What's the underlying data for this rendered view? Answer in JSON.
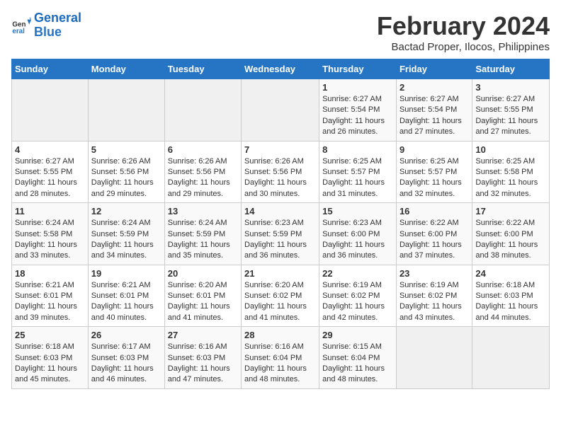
{
  "logo": {
    "line1": "General",
    "line2": "Blue"
  },
  "title": "February 2024",
  "location": "Bactad Proper, Ilocos, Philippines",
  "headers": [
    "Sunday",
    "Monday",
    "Tuesday",
    "Wednesday",
    "Thursday",
    "Friday",
    "Saturday"
  ],
  "weeks": [
    [
      {
        "day": "",
        "info": ""
      },
      {
        "day": "",
        "info": ""
      },
      {
        "day": "",
        "info": ""
      },
      {
        "day": "",
        "info": ""
      },
      {
        "day": "1",
        "info": "Sunrise: 6:27 AM\nSunset: 5:54 PM\nDaylight: 11 hours and 26 minutes."
      },
      {
        "day": "2",
        "info": "Sunrise: 6:27 AM\nSunset: 5:54 PM\nDaylight: 11 hours and 27 minutes."
      },
      {
        "day": "3",
        "info": "Sunrise: 6:27 AM\nSunset: 5:55 PM\nDaylight: 11 hours and 27 minutes."
      }
    ],
    [
      {
        "day": "4",
        "info": "Sunrise: 6:27 AM\nSunset: 5:55 PM\nDaylight: 11 hours and 28 minutes."
      },
      {
        "day": "5",
        "info": "Sunrise: 6:26 AM\nSunset: 5:56 PM\nDaylight: 11 hours and 29 minutes."
      },
      {
        "day": "6",
        "info": "Sunrise: 6:26 AM\nSunset: 5:56 PM\nDaylight: 11 hours and 29 minutes."
      },
      {
        "day": "7",
        "info": "Sunrise: 6:26 AM\nSunset: 5:56 PM\nDaylight: 11 hours and 30 minutes."
      },
      {
        "day": "8",
        "info": "Sunrise: 6:25 AM\nSunset: 5:57 PM\nDaylight: 11 hours and 31 minutes."
      },
      {
        "day": "9",
        "info": "Sunrise: 6:25 AM\nSunset: 5:57 PM\nDaylight: 11 hours and 32 minutes."
      },
      {
        "day": "10",
        "info": "Sunrise: 6:25 AM\nSunset: 5:58 PM\nDaylight: 11 hours and 32 minutes."
      }
    ],
    [
      {
        "day": "11",
        "info": "Sunrise: 6:24 AM\nSunset: 5:58 PM\nDaylight: 11 hours and 33 minutes."
      },
      {
        "day": "12",
        "info": "Sunrise: 6:24 AM\nSunset: 5:59 PM\nDaylight: 11 hours and 34 minutes."
      },
      {
        "day": "13",
        "info": "Sunrise: 6:24 AM\nSunset: 5:59 PM\nDaylight: 11 hours and 35 minutes."
      },
      {
        "day": "14",
        "info": "Sunrise: 6:23 AM\nSunset: 5:59 PM\nDaylight: 11 hours and 36 minutes."
      },
      {
        "day": "15",
        "info": "Sunrise: 6:23 AM\nSunset: 6:00 PM\nDaylight: 11 hours and 36 minutes."
      },
      {
        "day": "16",
        "info": "Sunrise: 6:22 AM\nSunset: 6:00 PM\nDaylight: 11 hours and 37 minutes."
      },
      {
        "day": "17",
        "info": "Sunrise: 6:22 AM\nSunset: 6:00 PM\nDaylight: 11 hours and 38 minutes."
      }
    ],
    [
      {
        "day": "18",
        "info": "Sunrise: 6:21 AM\nSunset: 6:01 PM\nDaylight: 11 hours and 39 minutes."
      },
      {
        "day": "19",
        "info": "Sunrise: 6:21 AM\nSunset: 6:01 PM\nDaylight: 11 hours and 40 minutes."
      },
      {
        "day": "20",
        "info": "Sunrise: 6:20 AM\nSunset: 6:01 PM\nDaylight: 11 hours and 41 minutes."
      },
      {
        "day": "21",
        "info": "Sunrise: 6:20 AM\nSunset: 6:02 PM\nDaylight: 11 hours and 41 minutes."
      },
      {
        "day": "22",
        "info": "Sunrise: 6:19 AM\nSunset: 6:02 PM\nDaylight: 11 hours and 42 minutes."
      },
      {
        "day": "23",
        "info": "Sunrise: 6:19 AM\nSunset: 6:02 PM\nDaylight: 11 hours and 43 minutes."
      },
      {
        "day": "24",
        "info": "Sunrise: 6:18 AM\nSunset: 6:03 PM\nDaylight: 11 hours and 44 minutes."
      }
    ],
    [
      {
        "day": "25",
        "info": "Sunrise: 6:18 AM\nSunset: 6:03 PM\nDaylight: 11 hours and 45 minutes."
      },
      {
        "day": "26",
        "info": "Sunrise: 6:17 AM\nSunset: 6:03 PM\nDaylight: 11 hours and 46 minutes."
      },
      {
        "day": "27",
        "info": "Sunrise: 6:16 AM\nSunset: 6:03 PM\nDaylight: 11 hours and 47 minutes."
      },
      {
        "day": "28",
        "info": "Sunrise: 6:16 AM\nSunset: 6:04 PM\nDaylight: 11 hours and 48 minutes."
      },
      {
        "day": "29",
        "info": "Sunrise: 6:15 AM\nSunset: 6:04 PM\nDaylight: 11 hours and 48 minutes."
      },
      {
        "day": "",
        "info": ""
      },
      {
        "day": "",
        "info": ""
      }
    ]
  ]
}
